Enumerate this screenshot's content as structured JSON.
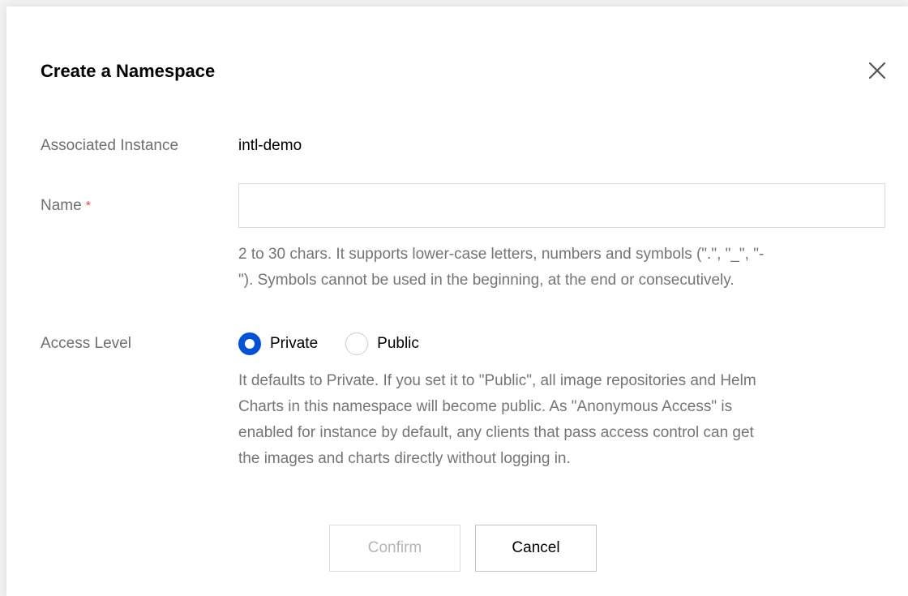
{
  "dialog": {
    "title": "Create a Namespace",
    "close_icon": "close-icon"
  },
  "form": {
    "instance": {
      "label": "Associated Instance",
      "value": "intl-demo"
    },
    "name": {
      "label": "Name",
      "required_mark": "*",
      "value": "",
      "placeholder": "",
      "help_line1": "2 to 30 chars. It supports lower-case letters, numbers and symbols (\".\", \"_\", \"-",
      "help_line2": "\"). Symbols cannot be used in the beginning, at the end or consecutively."
    },
    "access": {
      "label": "Access Level",
      "options": [
        {
          "label": "Private",
          "checked": true
        },
        {
          "label": "Public",
          "checked": false
        }
      ],
      "help_lines": [
        "It defaults to Private. If you set it to \"Public\", all image repositories and Helm",
        "Charts in this namespace will become public. As \"Anonymous Access\" is",
        "enabled for instance by default, any clients that pass access control can get",
        "the images and charts directly without logging in."
      ]
    }
  },
  "buttons": {
    "confirm": "Confirm",
    "cancel": "Cancel"
  },
  "colors": {
    "accent": "#0052d9",
    "required": "#e54545",
    "label": "#6f6f6f",
    "help": "#757575"
  }
}
